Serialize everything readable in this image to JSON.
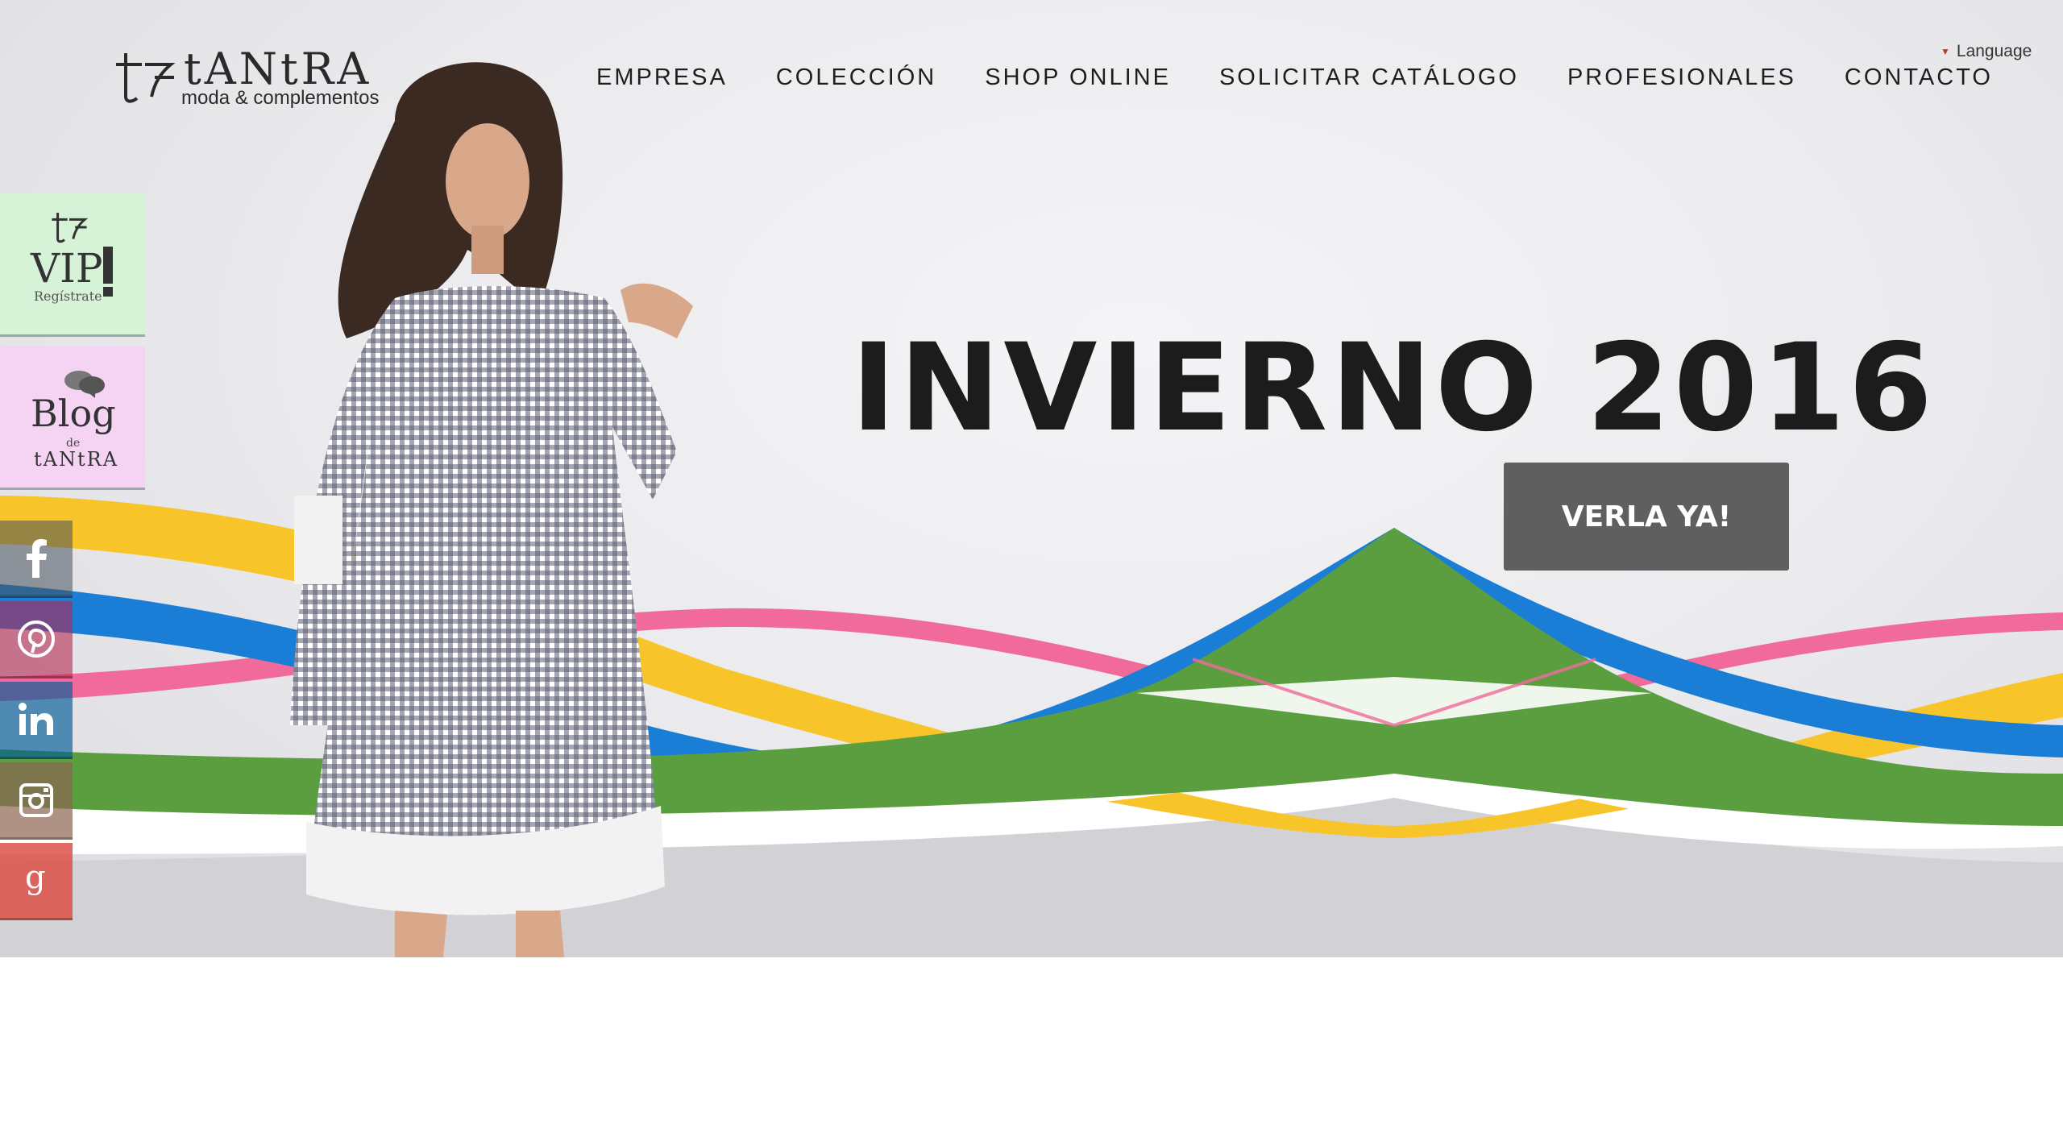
{
  "brand": {
    "name": "tANtRA",
    "tagline": "moda & complementos"
  },
  "nav": {
    "items": [
      "EMPRESA",
      "COLECCIÓN",
      "SHOP ONLINE",
      "SOLICITAR CATÁLOGO",
      "PROFESIONALES",
      "CONTACTO"
    ],
    "language_label": "Language"
  },
  "hero": {
    "headline": "INVIERNO 2016",
    "cta_label": "VERLA YA!"
  },
  "sidebar": {
    "vip": {
      "title": "VIP",
      "subtitle": "Regístrate"
    },
    "blog": {
      "title": "Blog",
      "de": "de",
      "brand": "tANtRA"
    },
    "social": [
      "facebook-icon",
      "pinterest-icon",
      "linkedin-icon",
      "instagram-icon",
      "googleplus-icon"
    ]
  },
  "colors": {
    "ribbon_yellow": "#f7c42a",
    "ribbon_blue": "#1a7dd6",
    "ribbon_green": "#5a9e40",
    "ribbon_pink": "#f06b9a",
    "cta_bg": "#5f5f5f"
  }
}
